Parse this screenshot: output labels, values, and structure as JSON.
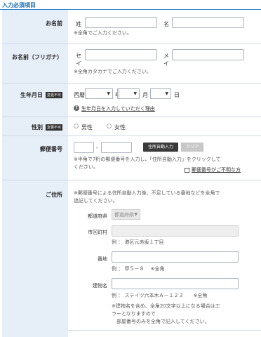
{
  "section_title": "入力必須項目",
  "name": {
    "label": "お名前",
    "sei_prefix": "姓",
    "mei_prefix": "名",
    "sei_value": "",
    "mei_value": "",
    "note": "※全角でご入力ください。"
  },
  "furigana": {
    "label": "お名前（フリガナ）",
    "sei_prefix": "セ\nイ",
    "mei_prefix": "メ\nイ",
    "sei_value": "",
    "mei_value": "",
    "note": "※全角カタカナでご入力ください。"
  },
  "birthday": {
    "label": "生年月日",
    "badge": "変更不可",
    "era": "西暦",
    "year_suffix": "年",
    "month_suffix": "月",
    "day_suffix": "日",
    "year_value": "",
    "month_value": "",
    "day_value": "",
    "help_icon": "?",
    "help_link": "生年月日を入力していただく理由"
  },
  "gender": {
    "label": "性別",
    "badge": "変更不可",
    "options": [
      "男性",
      "女性"
    ]
  },
  "postal": {
    "label": "郵便番号",
    "separator": "-",
    "auto_button": "住所自動入力",
    "clear_button": "クリア",
    "note": "※半角で7桁の郵便番号を入力し、「住所自動入力」をクリックして\nください。",
    "unknown_link": "郵便番号がご不明な方"
  },
  "address": {
    "label": "ご住所",
    "note": "※郵便番号による住所自動入力後、不足している番地などを全角で\n追記してください。",
    "prefecture_label": "都道府県",
    "prefecture_value": "都道府県",
    "city_label": "市区町村",
    "city_example": "例 ： 港区元赤坂１丁目",
    "banchi_label": "番地",
    "banchi_example": "例 ： 甲５－８　 ※全角",
    "building_label": "建物名",
    "building_example": "例 ： ステイツ六本木Ａ－１２３　　※全角",
    "building_note": "※建物名を含め、全角20文字以上になる場合はエ\nラーとなりますので\n　部屋番号のみを全角で記入してください。"
  }
}
